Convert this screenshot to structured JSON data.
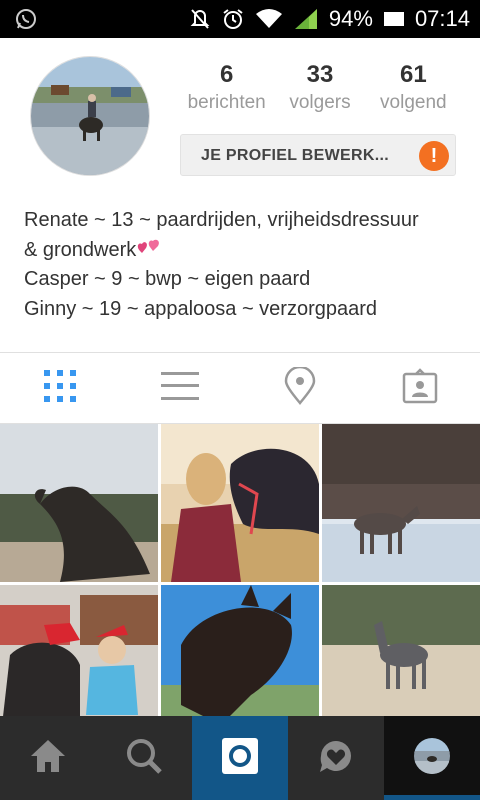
{
  "status_bar": {
    "battery": "94%",
    "time": "07:14",
    "icons": [
      "whatsapp-icon",
      "mute-icon",
      "alarm-icon",
      "wifi-icon",
      "signal-icon",
      "battery-icon"
    ]
  },
  "profile": {
    "stats": [
      {
        "count": "6",
        "label": "berichten"
      },
      {
        "count": "33",
        "label": "volgers"
      },
      {
        "count": "61",
        "label": "volgend"
      }
    ],
    "edit_button_label": "JE PROFIEL BEWERK...",
    "edit_warning": "!",
    "bio_lines": [
      "Renate ~ 13 ~ paardrijden, vrijheidsdressuur",
      "& grondwerk",
      "Casper ~ 9 ~ bwp ~ eigen paard",
      "Ginny ~ 19 ~ appaloosa ~ verzorgpaard"
    ],
    "bio_emoji": "two-hearts-icon"
  },
  "view_tabs": [
    {
      "icon": "grid-icon",
      "active": true
    },
    {
      "icon": "list-icon",
      "active": false
    },
    {
      "icon": "location-pin-icon",
      "active": false
    },
    {
      "icon": "tagged-photos-icon",
      "active": false
    }
  ],
  "photos": [
    "horse-rearing-dark-photo",
    "girl-with-horse-photo",
    "horse-in-snowy-field-photo",
    "christmas-hats-photo",
    "horse-closeup-sky-photo",
    "grey-horse-arena-photo"
  ],
  "bottom_nav": [
    {
      "icon": "home-icon"
    },
    {
      "icon": "search-icon"
    },
    {
      "icon": "camera-icon"
    },
    {
      "icon": "activity-heart-icon"
    },
    {
      "icon": "profile-avatar-icon"
    }
  ],
  "colors": {
    "accent_blue": "#3897f0",
    "camera_blue": "#125688",
    "warning_orange": "#f37021",
    "stat_label_gray": "#9a9a9a"
  }
}
